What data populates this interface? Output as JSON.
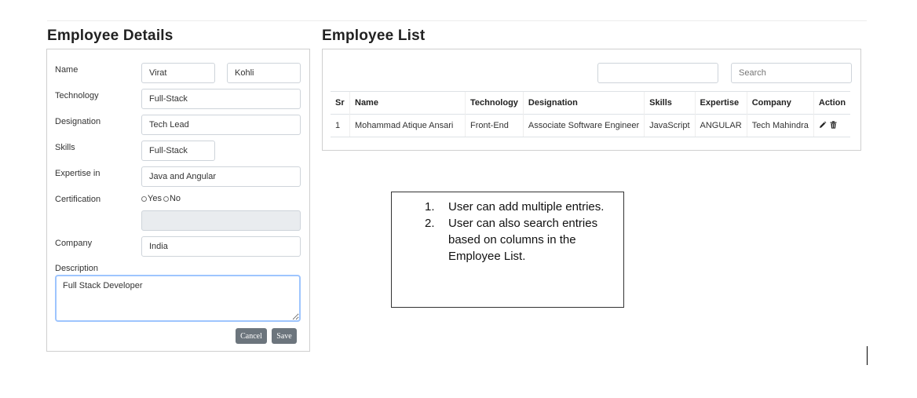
{
  "details": {
    "title": "Employee Details",
    "labels": {
      "name": "Name",
      "technology": "Technology",
      "designation": "Designation",
      "skills": "Skills",
      "expertise": "Expertise in",
      "certification": "Certification",
      "company": "Company",
      "description": "Description"
    },
    "values": {
      "first_name": "Virat",
      "last_name": "Kohli",
      "technology": "Full-Stack",
      "designation": "Tech Lead",
      "skills": "Full-Stack",
      "expertise": "Java and Angular",
      "certification_detail": "",
      "company": "India",
      "description": "Full Stack Developer"
    },
    "certification_options": {
      "yes": "Yes",
      "no": "No"
    },
    "buttons": {
      "cancel": "Cancel",
      "save": "Save"
    }
  },
  "list": {
    "title": "Employee List",
    "filter_value": "",
    "search_placeholder": "Search",
    "columns": [
      "Sr",
      "Name",
      "Technology",
      "Designation",
      "Skills",
      "Expertise",
      "Company",
      "Action"
    ],
    "rows": [
      {
        "sr": "1",
        "name": "Mohammad Atique Ansari",
        "technology": "Front-End",
        "designation": "Associate Software Engineer",
        "skills": "JavaScript",
        "expertise": "ANGULAR",
        "company": "Tech Mahindra",
        "actions": [
          "pencil-icon",
          "trash-icon"
        ]
      }
    ]
  },
  "notes": {
    "items": [
      {
        "num": "1.",
        "text": "User can add multiple entries."
      },
      {
        "num": "2.",
        "text": "User can also search entries based on columns in the Employee List."
      }
    ]
  }
}
